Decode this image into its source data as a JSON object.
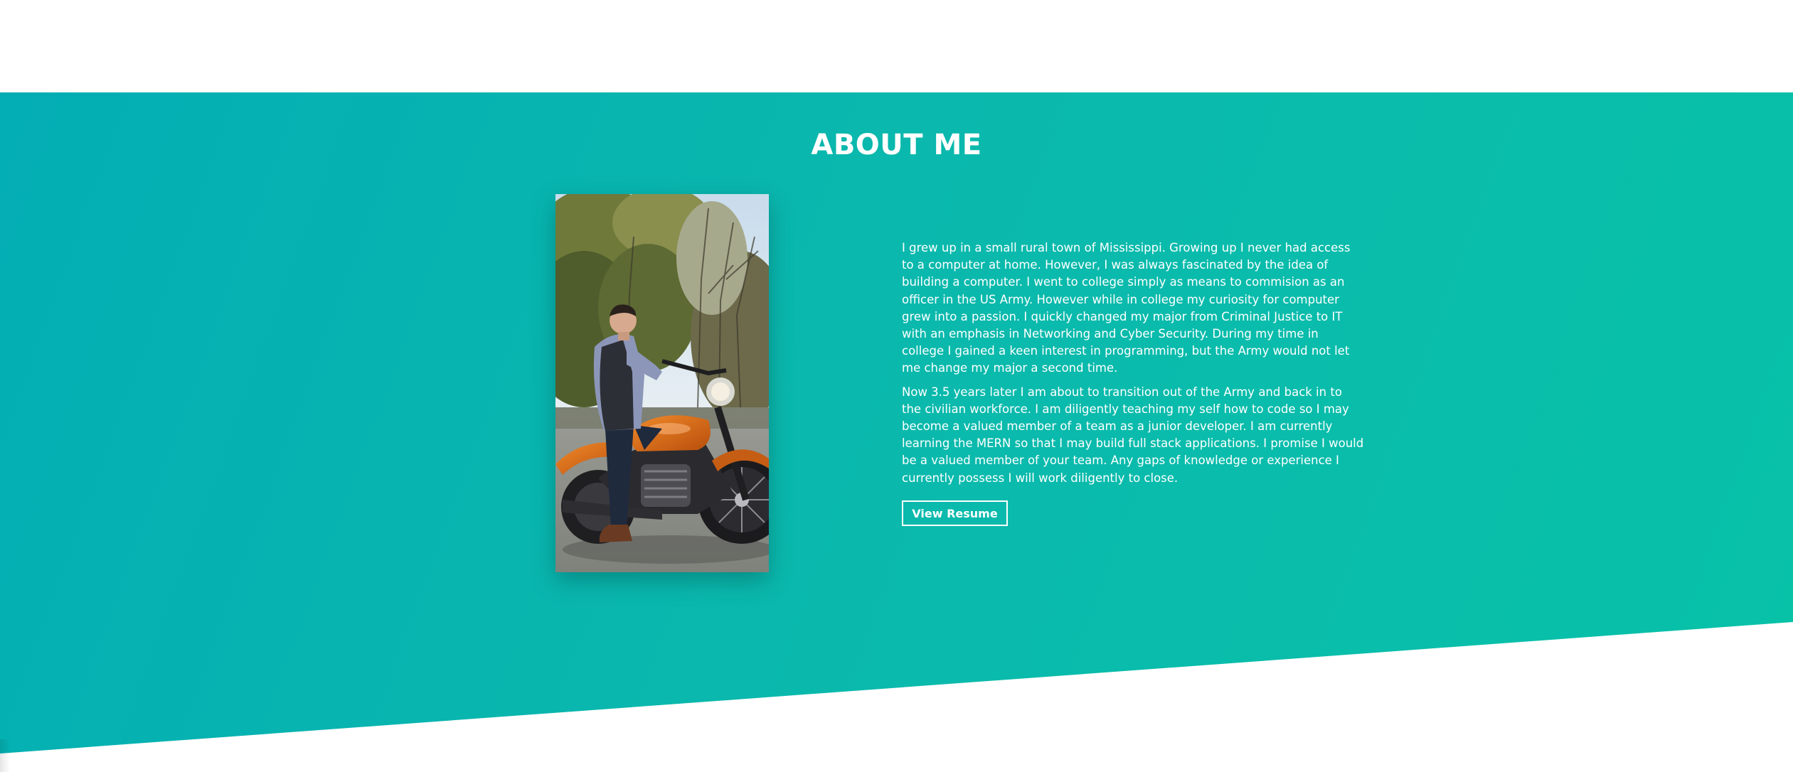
{
  "about": {
    "title": "ABOUT ME",
    "paragraphs": [
      "I grew up in a small rural town of Mississippi. Growing up I never had access to a computer at home. However, I was always fascinated by the idea of building a computer. I went to college simply as means to commision as an officer in the US Army. However while in college my curiosity for computer grew into a passion. I quickly changed my major from Criminal Justice to IT with an emphasis in Networking and Cyber Security. During my time in college I gained a keen interest in programming, but the Army would not let me change my major a second time.",
      "Now 3.5 years later I am about to transition out of the Army and back in to the civilian workforce. I am diligently teaching my self how to code so I may become a valued member of a team as a junior developer. I am currently learning the MERN so that I may build full stack applications. I promise I would be a valued member of your team. Any gaps of knowledge or experience I currently possess I will work diligently to close."
    ],
    "resume_button": "View Resume"
  },
  "colors": {
    "section_gradient_start": "#03aeb4",
    "section_gradient_end": "#08c2a8",
    "text": "#ffffff"
  }
}
